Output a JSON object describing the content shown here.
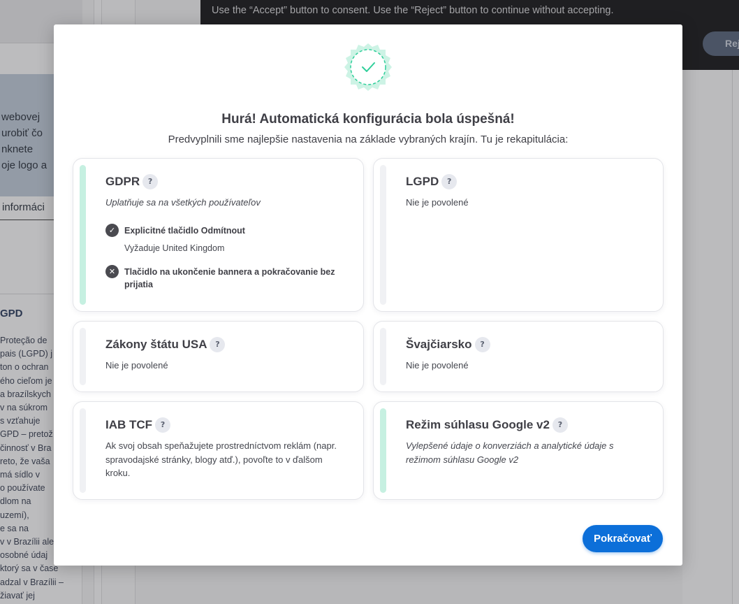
{
  "background": {
    "banner_text": "Use the “Accept” button to consent. Use the “Reject” button to continue without accepting.",
    "reject_label": "Rej",
    "left_lines": [
      "webovej",
      "urobiť čo",
      "nknete",
      "oje logo a"
    ],
    "info_link": "informáci",
    "section_heading": "GPD",
    "paragraph_lines": [
      "Proteção de",
      "pais (LGPD) j",
      "ton o ochran",
      "ého cieľom je",
      "a brazílskych",
      "v na súkrom",
      "s vzťahuje",
      "GPD – pretož",
      "činnosť v Bra",
      "reto, že vaša",
      "má sídlo v",
      "o používate",
      "dlom na",
      "uzemí),",
      "e sa na",
      "v v Brazílii ale",
      "osobné údaj",
      "ktorý sa v čase",
      "adzal v Brazílii –",
      "žiavať jej"
    ]
  },
  "modal": {
    "title": "Hurá! Automatická konfigurácia bola úspešná!",
    "subtitle": "Predvyplnili sme najlepšie nastavenia na základe vybraných krajín. Tu je rekapitulácia:",
    "help_glyph": "?",
    "cards": {
      "gdpr": {
        "title": "GDPR",
        "desc": "Uplatňuje sa na všetkých používateľov",
        "features": [
          {
            "label": "Explicitné tlačidlo Odmítnout",
            "note": "Vyžaduje United Kingdom",
            "status": "enabled",
            "glyph": "✓"
          },
          {
            "label": "Tlačidlo na ukončenie bannera a pokračovanie bez prijatia",
            "status": "disabled",
            "glyph": "✕"
          }
        ]
      },
      "lgpd": {
        "title": "LGPD",
        "desc": "Nie je povolené"
      },
      "usa": {
        "title": "Zákony štátu USA",
        "desc": "Nie je povolené"
      },
      "swiss": {
        "title": "Švajčiarsko",
        "desc": "Nie je povolené"
      },
      "iab": {
        "title": "IAB TCF",
        "desc": "Ak svoj obsah speňažujete prostredníctvom reklám (napr. spravodajské stránky, blogy atď.), povoľte to v ďalšom kroku."
      },
      "google": {
        "title": "Režim súhlasu Google v2",
        "desc": "Vylepšené údaje o konverziách a analytické údaje s režimom súhlasu Google v2"
      }
    },
    "continue_label": "Pokračovať"
  },
  "colors": {
    "accent_green": "#2fcf9a",
    "enabled_bar": "#c6f0e1",
    "disabled_bar": "#f0f1f4",
    "primary_button": "#0c6fd9"
  }
}
